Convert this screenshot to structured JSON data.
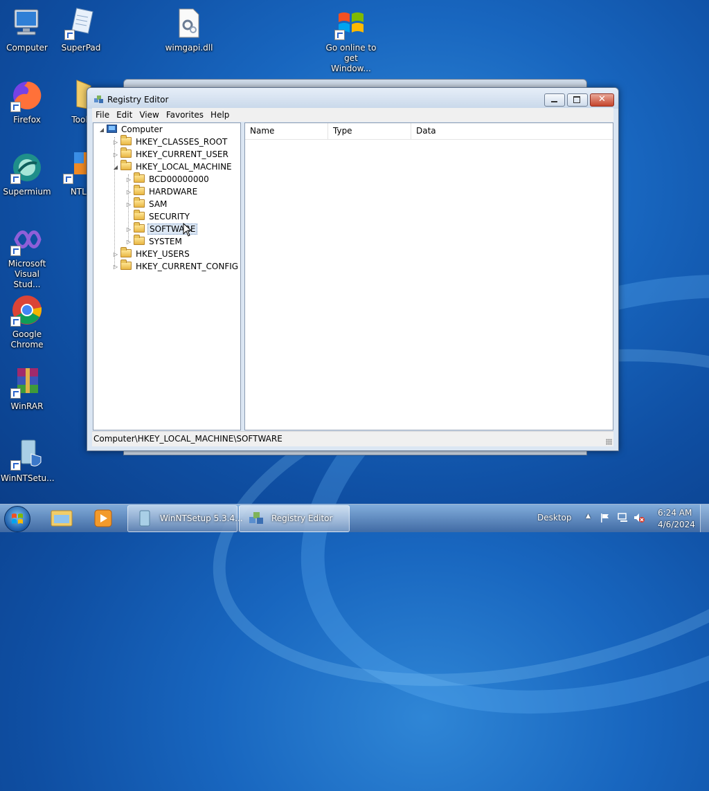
{
  "desktop": {
    "icons": [
      {
        "label": "Computer"
      },
      {
        "label": "SuperPad"
      },
      {
        "label": "wimgapi.dll"
      },
      {
        "label": "Go online to get Window..."
      },
      {
        "label": "Firefox"
      },
      {
        "label": "Tool"
      },
      {
        "label": "Supermium"
      },
      {
        "label": "NTLi"
      },
      {
        "label": "Microsoft Visual Stud..."
      },
      {
        "label": "Google Chrome"
      },
      {
        "label": "WinRAR"
      },
      {
        "label": "WinNTSetu..."
      }
    ]
  },
  "window": {
    "title": "Registry Editor",
    "menu": [
      "File",
      "Edit",
      "View",
      "Favorites",
      "Help"
    ],
    "tree": {
      "root": "Computer",
      "hives": [
        "HKEY_CLASSES_ROOT",
        "HKEY_CURRENT_USER",
        "HKEY_LOCAL_MACHINE",
        "HKEY_USERS",
        "HKEY_CURRENT_CONFIG"
      ],
      "hklm_children": [
        "BCD00000000",
        "HARDWARE",
        "SAM",
        "SECURITY",
        "SOFTWARE",
        "SYSTEM"
      ],
      "selected": "SOFTWARE"
    },
    "columns": [
      "Name",
      "Type",
      "Data"
    ],
    "status": "Computer\\HKEY_LOCAL_MACHINE\\SOFTWARE"
  },
  "taskbar": {
    "buttons": [
      {
        "label": "WinNTSetup 5.3.4..."
      },
      {
        "label": "Registry Editor"
      }
    ],
    "desktop_label": "Desktop",
    "time": "6:24 AM",
    "date": "4/6/2024"
  },
  "colors": {
    "selection": "#dde8f5",
    "titlebar": "#c9d8ea",
    "close": "#c5442b"
  }
}
